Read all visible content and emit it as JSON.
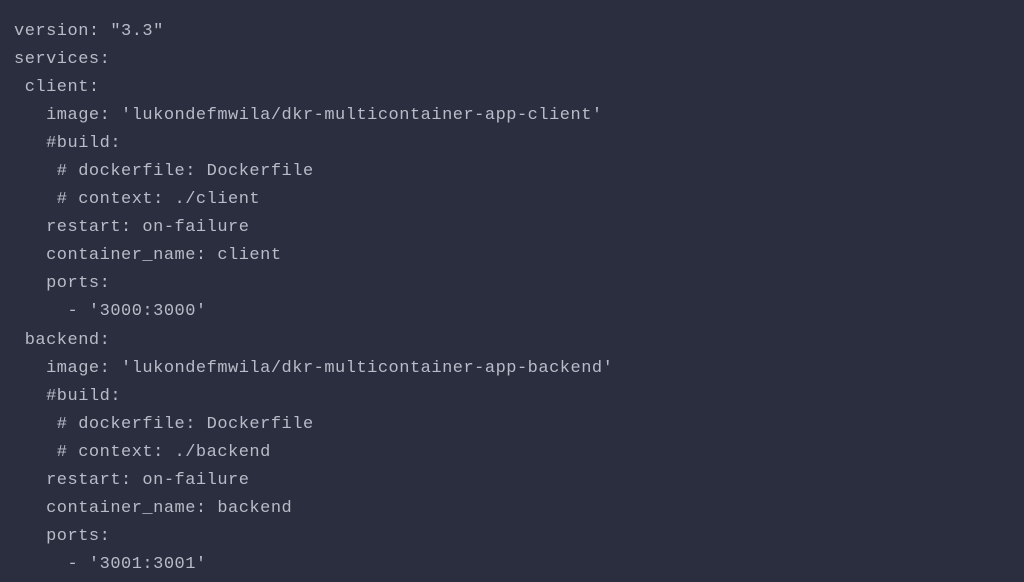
{
  "lines": [
    "version: \"3.3\"",
    "services:",
    " client:",
    "   image: 'lukondefmwila/dkr-multicontainer-app-client'",
    "   #build:",
    "    # dockerfile: Dockerfile",
    "    # context: ./client",
    "   restart: on-failure",
    "   container_name: client",
    "   ports:",
    "     - '3000:3000'",
    " backend:",
    "   image: 'lukondefmwila/dkr-multicontainer-app-backend'",
    "   #build:",
    "    # dockerfile: Dockerfile",
    "    # context: ./backend",
    "   restart: on-failure",
    "   container_name: backend",
    "   ports:",
    "     - '3001:3001'"
  ]
}
